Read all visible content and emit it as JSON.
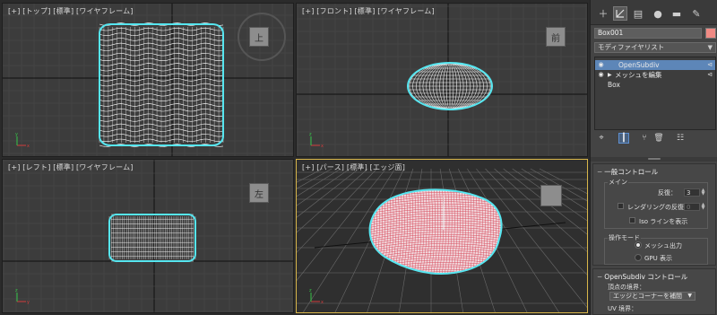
{
  "viewports": {
    "top": {
      "label": "[+] [トップ] [標準] [ワイヤフレーム]",
      "cube_label": "上"
    },
    "front": {
      "label": "[+] [フロント] [標準] [ワイヤフレーム]",
      "cube_label": "前"
    },
    "left": {
      "label": "[+] [レフト] [標準] [ワイヤフレーム]",
      "cube_label": "左"
    },
    "perspective": {
      "label": "[+] [パース] [標準] [エッジ面]"
    }
  },
  "colors": {
    "viewport_bg": "#3c3c3c",
    "wire": "#ffffff",
    "selection_outline": "#56e6f0",
    "active_border": "#d8b64a",
    "persp_mesh": "#d6495a",
    "stack_highlight": "#5d86b8",
    "object_color": "#f08a84"
  },
  "panel": {
    "tabs": [
      "create-icon",
      "modify-icon",
      "hierarchy-icon",
      "motion-icon",
      "display-icon",
      "utilities-icon"
    ],
    "object_name": "Box001",
    "modifier_list": "モディファイヤリスト",
    "stack": [
      {
        "label": "OpenSubdiv",
        "selected": true
      },
      {
        "label": "メッシュを編集",
        "selected": false
      },
      {
        "label": "Box",
        "selected": false
      }
    ],
    "rollouts": {
      "general": {
        "title": "一般コントロール",
        "main_group": "メイン",
        "iterations_label": "反復：",
        "iterations_value": "3",
        "render_iter_label": "レンダリングの反復：",
        "render_iter_value": "0",
        "iso_label": "Iso ラインを表示",
        "mode_group": "操作モード",
        "mode_mesh": "メッシュ出力",
        "mode_gpu": "GPU 表示"
      },
      "opensubdiv": {
        "title": "OpenSubdiv コントロール",
        "vertex_boundary_label": "頂点の境界：",
        "vertex_boundary_value": "エッジとコーナーを補間",
        "uv_boundary_label": "UV 境界："
      }
    }
  }
}
